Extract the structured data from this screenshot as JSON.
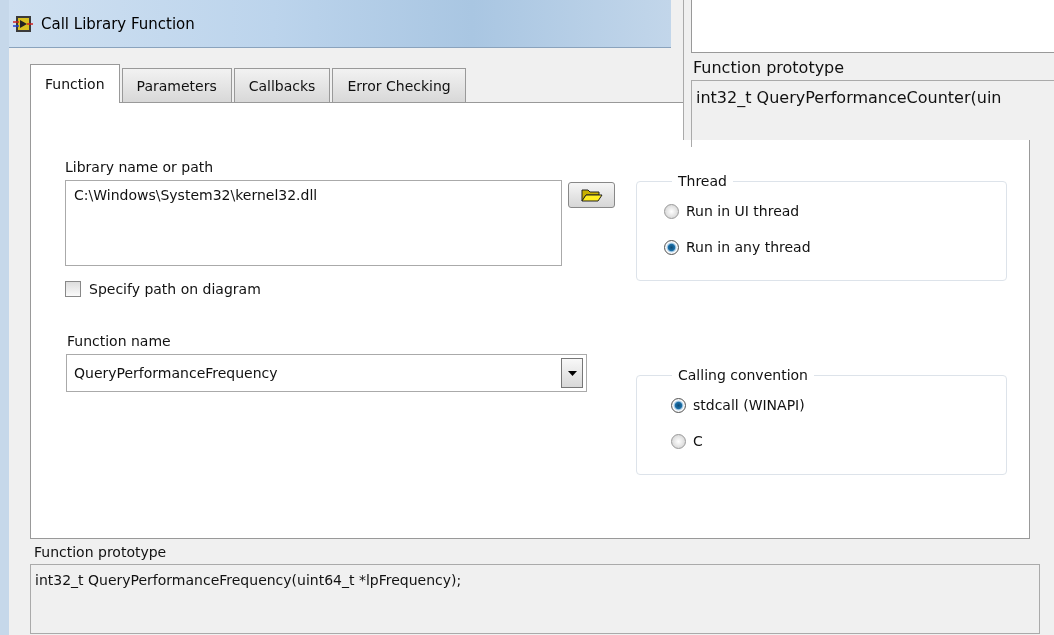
{
  "back_window": {
    "section_label": "Function prototype",
    "prototype": "int32_t QueryPerformanceCounter(uin"
  },
  "window": {
    "title": "Call Library Function"
  },
  "tabs": [
    {
      "label": "Function",
      "selected": true
    },
    {
      "label": "Parameters",
      "selected": false
    },
    {
      "label": "Callbacks",
      "selected": false
    },
    {
      "label": "Error Checking",
      "selected": false
    }
  ],
  "library": {
    "label": "Library name or path",
    "value": "C:\\Windows\\System32\\kernel32.dll"
  },
  "specify_path": {
    "label": "Specify path on diagram",
    "checked": false
  },
  "function_name": {
    "label": "Function name",
    "value": "QueryPerformanceFrequency"
  },
  "groups": [
    {
      "title": "Thread",
      "options": [
        {
          "label": "Run in UI thread",
          "selected": false
        },
        {
          "label": "Run in any thread",
          "selected": true
        }
      ]
    },
    {
      "title": "Calling convention",
      "options": [
        {
          "label": "stdcall (WINAPI)",
          "selected": true
        },
        {
          "label": "C",
          "selected": false
        }
      ]
    }
  ],
  "prototype": {
    "label": "Function prototype",
    "value": "int32_t QueryPerformanceFrequency(uint64_t *lpFrequency);"
  }
}
